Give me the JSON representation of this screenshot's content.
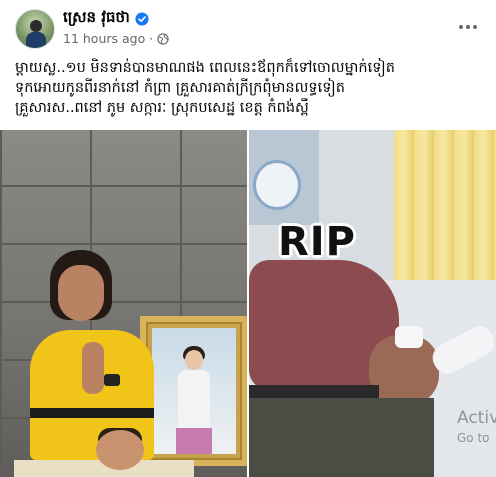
{
  "post": {
    "author": "ស្រេន វុធថា",
    "timestamp": "11 hours ago",
    "separator": "·",
    "audience_icon": "globe-icon",
    "verified_icon": "verified-badge-icon",
    "more_icon": "more-options-icon",
    "text_lines": [
      "ម្ដាយស្ល..១ប មិនទាន់បានមាណផង ពេលនេះឪពុកក៏ទៅចោលម្នាក់ទៀត",
      "ទុកអោយកូនពីរនាក់នៅ កំព្រា  គ្រួសារគាត់ក្រីក្រពុំមានលទ្ធទៀត",
      "គ្រួសារស..ពនៅ ភូម សក្ការៈ ស្រុកបសេដ្ឋ ខេត្ត កំពង់ស្ពឺ"
    ]
  },
  "photos": {
    "left_alt": "girl with hands pressed together beside framed portrait",
    "right_overlay": "RIP"
  },
  "watermark": {
    "line1": "Activ",
    "line2": "Go to"
  },
  "colors": {
    "verified": "#1877f2",
    "meta_text": "#65676b"
  }
}
